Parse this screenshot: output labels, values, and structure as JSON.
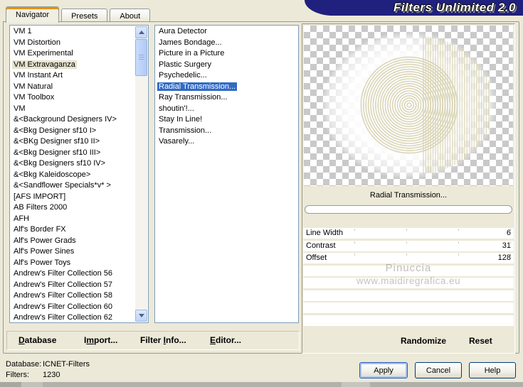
{
  "window": {
    "title": "Filters Unlimited 2.0"
  },
  "tabs": [
    {
      "label": "Navigator",
      "state": "active"
    },
    {
      "label": "Presets"
    },
    {
      "label": "About"
    }
  ],
  "category_list": {
    "items": [
      {
        "label": "VM 1"
      },
      {
        "label": "VM Distortion"
      },
      {
        "label": "VM Experimental"
      },
      {
        "label": "VM Extravaganza",
        "state": "highlight"
      },
      {
        "label": "VM Instant Art"
      },
      {
        "label": "VM Natural"
      },
      {
        "label": "VM Toolbox"
      },
      {
        "label": "VM"
      },
      {
        "label": "&<Background Designers IV>"
      },
      {
        "label": "&<Bkg Designer sf10 I>"
      },
      {
        "label": "&<BKg Designer sf10 II>"
      },
      {
        "label": "&<Bkg Designer sf10 III>"
      },
      {
        "label": "&<Bkg Designers sf10 IV>"
      },
      {
        "label": "&<Bkg Kaleidoscope>"
      },
      {
        "label": "&<Sandflower Specials*v* >"
      },
      {
        "label": "[AFS IMPORT]"
      },
      {
        "label": "AB Filters 2000"
      },
      {
        "label": "AFH"
      },
      {
        "label": "Alf's Border FX"
      },
      {
        "label": "Alf's Power Grads"
      },
      {
        "label": "Alf's Power Sines"
      },
      {
        "label": "Alf's Power Toys"
      },
      {
        "label": "Andrew's Filter Collection 56"
      },
      {
        "label": "Andrew's Filter Collection 57"
      },
      {
        "label": "Andrew's Filter Collection 58"
      },
      {
        "label": "Andrew's Filter Collection 60"
      },
      {
        "label": "Andrew's Filter Collection 62"
      }
    ]
  },
  "filter_list": {
    "items": [
      {
        "label": "Aura Detector"
      },
      {
        "label": "James Bondage..."
      },
      {
        "label": "Picture in a Picture"
      },
      {
        "label": "Plastic Surgery"
      },
      {
        "label": "Psychedelic..."
      },
      {
        "label": "Radial Transmission...",
        "state": "selected"
      },
      {
        "label": "Ray Transmission..."
      },
      {
        "label": "shoutin'!..."
      },
      {
        "label": "Stay In Line!"
      },
      {
        "label": "Transmission..."
      },
      {
        "label": "Vasarely..."
      }
    ]
  },
  "preview": {
    "filter_name": "Radial Transmission...",
    "progress_percent": 0
  },
  "parameters": [
    {
      "name": "Line Width",
      "value": "6"
    },
    {
      "name": "Contrast",
      "value": "31"
    },
    {
      "name": "Offset",
      "value": "128"
    }
  ],
  "watermark": {
    "line1": "Pinuccia",
    "line2": "www.maidiregrafica.eu"
  },
  "actions": {
    "randomize": "Randomize",
    "reset": "Reset"
  },
  "menu_items": [
    {
      "pre": "",
      "key": "D",
      "post": "atabase"
    },
    {
      "pre": "I",
      "key": "m",
      "post": "port..."
    },
    {
      "pre": "Filter ",
      "key": "I",
      "post": "nfo..."
    },
    {
      "pre": "",
      "key": "E",
      "post": "ditor..."
    }
  ],
  "status": {
    "database_label": "Database:",
    "database_value": "ICNET-Filters",
    "filters_label": "Filters:",
    "filters_value": "1230"
  },
  "buttons": {
    "apply": "Apply",
    "cancel": "Cancel",
    "help": "Help"
  },
  "colors": {
    "selection": "#316AC5",
    "inactive_highlight": "#E7E3CE",
    "banner_blue": "#20207E",
    "ring_tan": "#D5CFAC",
    "dialog_background": "#ECE9D8"
  }
}
